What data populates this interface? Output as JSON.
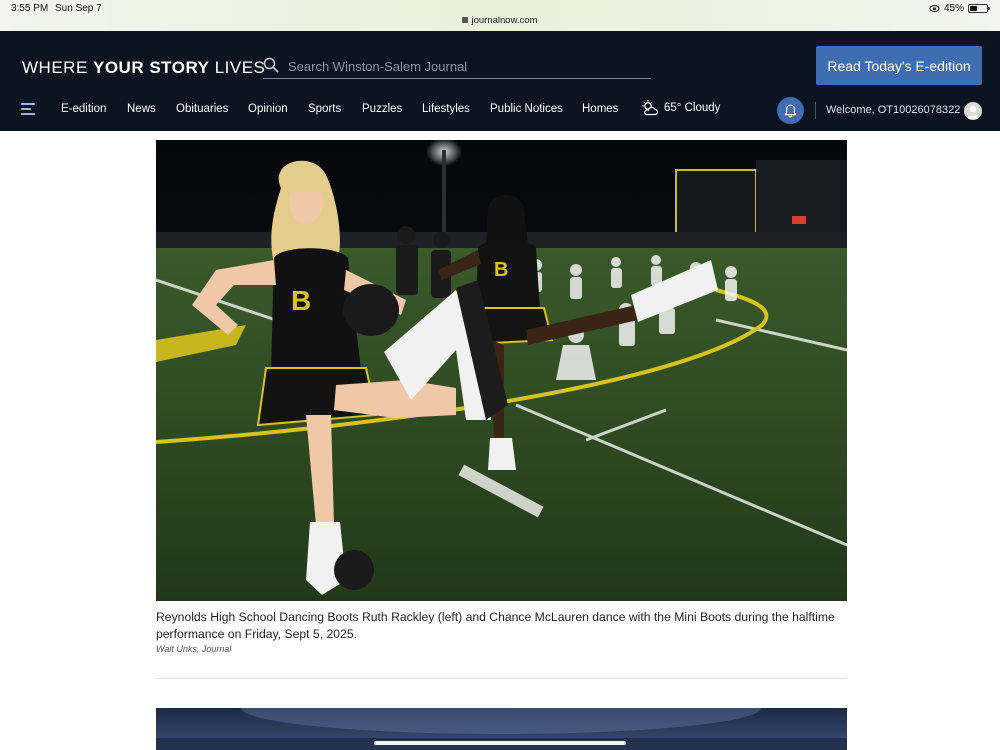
{
  "status_bar": {
    "time": "3:55 PM",
    "date": "Sun Sep 7",
    "url": "journalnow.com",
    "battery_percent": "45%",
    "battery_level": 0.45
  },
  "header": {
    "tagline_thin": "WHERE ",
    "tagline_bold": "YOUR STORY",
    "tagline_end": " LIVES",
    "search_placeholder": "Search Winston-Salem Journal",
    "eedition_button": "Read Today's E-edition",
    "nav": [
      "E-edition",
      "News",
      "Obituaries",
      "Opinion",
      "Sports",
      "Puzzles",
      "Lifestyles",
      "Public Notices",
      "Homes"
    ],
    "weather": "65° Cloudy",
    "welcome": "Welcome, OT10026078322"
  },
  "article": {
    "caption": "Reynolds High School Dancing Boots Ruth Rackley (left) and Chance McLauren dance with the Mini Boots during the halftime performance on Friday, Sept 5, 2025.",
    "credit": "Walt Unks, Journal"
  },
  "colors": {
    "header_bg": "#0c1321",
    "accent_blue": "#3f6db1",
    "field_green": "#2f4a22",
    "field_yellow": "#d8c21c"
  }
}
